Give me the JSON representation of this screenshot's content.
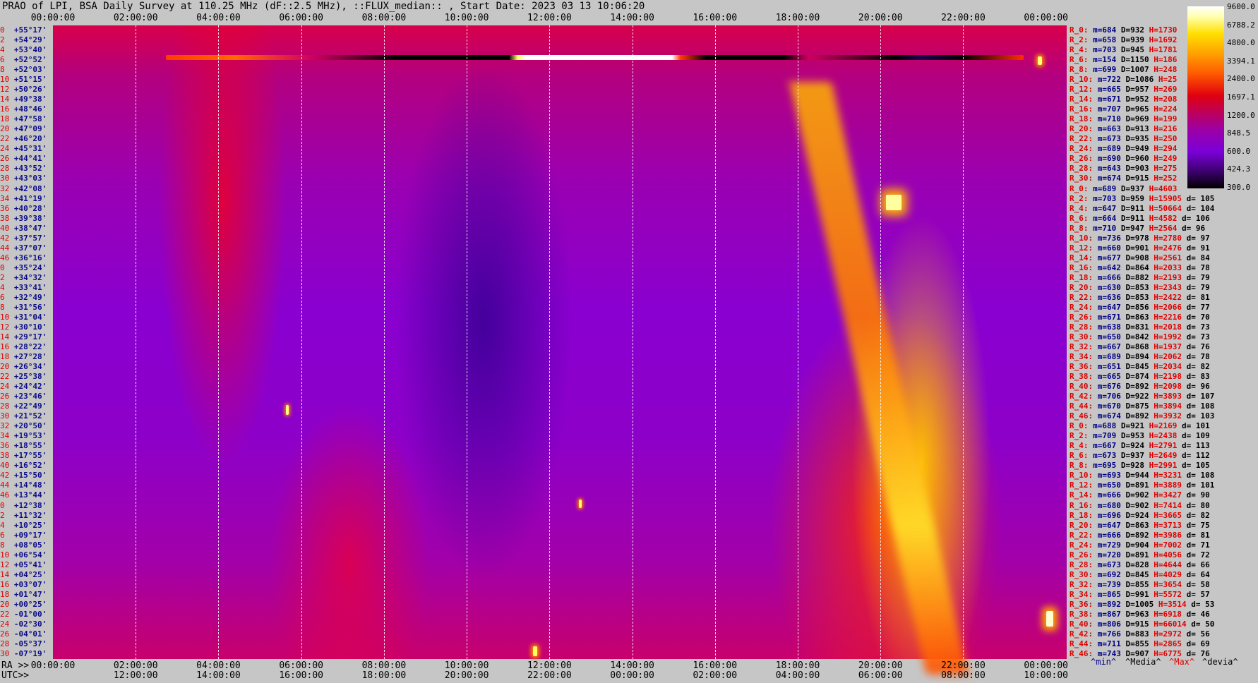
{
  "title": "PRAO of LPI, BSA Daily Survey at 110.25 MHz (dF::2.5 MHz), ::FLUX_median:: , Start Date: 2023 03 13 10:06:20",
  "top_axis": [
    "00:00:00",
    "02:00:00",
    "04:00:00",
    "06:00:00",
    "08:00:00",
    "10:00:00",
    "12:00:00",
    "14:00:00",
    "16:00:00",
    "18:00:00",
    "20:00:00",
    "22:00:00",
    "00:00:00"
  ],
  "bottom_axis": {
    "ra_prefix": "RA >>",
    "ra": [
      "00:00:00",
      "02:00:00",
      "04:00:00",
      "06:00:00",
      "08:00:00",
      "10:00:00",
      "12:00:00",
      "14:00:00",
      "16:00:00",
      "18:00:00",
      "20:00:00",
      "22:00:00",
      "00:00:00"
    ],
    "utc_prefix": "UTC>>",
    "utc": [
      "12:00:00",
      "14:00:00",
      "16:00:00",
      "18:00:00",
      "20:00:00",
      "22:00:00",
      "00:00:00",
      "02:00:00",
      "04:00:00",
      "06:00:00",
      "08:00:00",
      "10:00:00"
    ]
  },
  "declinations": [
    {
      "n": "0",
      "v": "+55°17'"
    },
    {
      "n": "2",
      "v": "+54°29'"
    },
    {
      "n": "4",
      "v": "+53°40'"
    },
    {
      "n": "6",
      "v": "+52°52'"
    },
    {
      "n": "8",
      "v": "+52°03'"
    },
    {
      "n": "10",
      "v": "+51°15'"
    },
    {
      "n": "12",
      "v": "+50°26'"
    },
    {
      "n": "14",
      "v": "+49°38'"
    },
    {
      "n": "16",
      "v": "+48°46'"
    },
    {
      "n": "18",
      "v": "+47°58'"
    },
    {
      "n": "20",
      "v": "+47°09'"
    },
    {
      "n": "22",
      "v": "+46°20'"
    },
    {
      "n": "24",
      "v": "+45°31'"
    },
    {
      "n": "26",
      "v": "+44°41'"
    },
    {
      "n": "28",
      "v": "+43°52'"
    },
    {
      "n": "30",
      "v": "+43°03'"
    },
    {
      "n": "32",
      "v": "+42°08'"
    },
    {
      "n": "34",
      "v": "+41°19'"
    },
    {
      "n": "36",
      "v": "+40°28'"
    },
    {
      "n": "38",
      "v": "+39°38'"
    },
    {
      "n": "40",
      "v": "+38°47'"
    },
    {
      "n": "42",
      "v": "+37°57'"
    },
    {
      "n": "44",
      "v": "+37°07'"
    },
    {
      "n": "46",
      "v": "+36°16'"
    },
    {
      "n": "0",
      "v": "+35°24'"
    },
    {
      "n": "2",
      "v": "+34°32'"
    },
    {
      "n": "4",
      "v": "+33°41'"
    },
    {
      "n": "6",
      "v": "+32°49'"
    },
    {
      "n": "8",
      "v": "+31°56'"
    },
    {
      "n": "10",
      "v": "+31°04'"
    },
    {
      "n": "12",
      "v": "+30°10'"
    },
    {
      "n": "14",
      "v": "+29°17'"
    },
    {
      "n": "16",
      "v": "+28°22'"
    },
    {
      "n": "18",
      "v": "+27°28'"
    },
    {
      "n": "20",
      "v": "+26°34'"
    },
    {
      "n": "22",
      "v": "+25°38'"
    },
    {
      "n": "24",
      "v": "+24°42'"
    },
    {
      "n": "26",
      "v": "+23°46'"
    },
    {
      "n": "28",
      "v": "+22°49'"
    },
    {
      "n": "30",
      "v": "+21°52'"
    },
    {
      "n": "32",
      "v": "+20°50'"
    },
    {
      "n": "34",
      "v": "+19°53'"
    },
    {
      "n": "36",
      "v": "+18°55'"
    },
    {
      "n": "38",
      "v": "+17°55'"
    },
    {
      "n": "40",
      "v": "+16°52'"
    },
    {
      "n": "42",
      "v": "+15°50'"
    },
    {
      "n": "44",
      "v": "+14°48'"
    },
    {
      "n": "46",
      "v": "+13°44'"
    },
    {
      "n": "0",
      "v": "+12°38'"
    },
    {
      "n": "2",
      "v": "+11°32'"
    },
    {
      "n": "4",
      "v": "+10°25'"
    },
    {
      "n": "6",
      "v": "+09°17'"
    },
    {
      "n": "8",
      "v": "+08°05'"
    },
    {
      "n": "10",
      "v": "+06°54'"
    },
    {
      "n": "12",
      "v": "+05°41'"
    },
    {
      "n": "14",
      "v": "+04°25'"
    },
    {
      "n": "16",
      "v": "+03°07'"
    },
    {
      "n": "18",
      "v": "+01°47'"
    },
    {
      "n": "20",
      "v": "+00°25'"
    },
    {
      "n": "22",
      "v": "-01°00'"
    },
    {
      "n": "24",
      "v": "-02°30'"
    },
    {
      "n": "26",
      "v": "-04°01'"
    },
    {
      "n": "28",
      "v": "-05°37'"
    },
    {
      "n": "30",
      "v": "-07°19'"
    }
  ],
  "stats": [
    {
      "r": "R_0:",
      "m": "m=684",
      "D": "D=932",
      "H": "H=1730",
      "d": ""
    },
    {
      "r": "R_2:",
      "m": "m=658",
      "D": "D=939",
      "H": "H=1692",
      "d": ""
    },
    {
      "r": "R_4:",
      "m": "m=703",
      "D": "D=945",
      "H": "H=1781",
      "d": ""
    },
    {
      "r": "R_6:",
      "m": "m=154",
      "D": "D=1150",
      "H": "H=186",
      "d": ""
    },
    {
      "r": "R_8:",
      "m": "m=699",
      "D": "D=1007",
      "H": "H=248",
      "d": ""
    },
    {
      "r": "R_10:",
      "m": "m=722",
      "D": "D=1086",
      "H": "H=25",
      "d": ""
    },
    {
      "r": "R_12:",
      "m": "m=665",
      "D": "D=957",
      "H": "H=269",
      "d": ""
    },
    {
      "r": "R_14:",
      "m": "m=671",
      "D": "D=952",
      "H": "H=208",
      "d": ""
    },
    {
      "r": "R_16:",
      "m": "m=707",
      "D": "D=965",
      "H": "H=224",
      "d": ""
    },
    {
      "r": "R_18:",
      "m": "m=710",
      "D": "D=969",
      "H": "H=199",
      "d": ""
    },
    {
      "r": "R_20:",
      "m": "m=663",
      "D": "D=913",
      "H": "H=216",
      "d": ""
    },
    {
      "r": "R_22:",
      "m": "m=673",
      "D": "D=935",
      "H": "H=250",
      "d": ""
    },
    {
      "r": "R_24:",
      "m": "m=689",
      "D": "D=949",
      "H": "H=294",
      "d": ""
    },
    {
      "r": "R_26:",
      "m": "m=690",
      "D": "D=960",
      "H": "H=249",
      "d": ""
    },
    {
      "r": "R_28:",
      "m": "m=643",
      "D": "D=903",
      "H": "H=275",
      "d": ""
    },
    {
      "r": "R_30:",
      "m": "m=674",
      "D": "D=915",
      "H": "H=252",
      "d": ""
    },
    {
      "r": "R_0:",
      "m": "m=689",
      "D": "D=937",
      "H": "H=4603",
      "d": ""
    },
    {
      "r": "R_2:",
      "m": "m=703",
      "D": "D=959",
      "H": "H=15905",
      "d": "d= 105"
    },
    {
      "r": "R_4:",
      "m": "m=647",
      "D": "D=911",
      "H": "H=50664",
      "d": "d= 104"
    },
    {
      "r": "R_6:",
      "m": "m=664",
      "D": "D=911",
      "H": "H=4582",
      "d": "d= 106"
    },
    {
      "r": "R_8:",
      "m": "m=710",
      "D": "D=947",
      "H": "H=2564",
      "d": "d= 96"
    },
    {
      "r": "R_10:",
      "m": "m=736",
      "D": "D=978",
      "H": "H=2780",
      "d": "d= 97"
    },
    {
      "r": "R_12:",
      "m": "m=660",
      "D": "D=901",
      "H": "H=2476",
      "d": "d= 91"
    },
    {
      "r": "R_14:",
      "m": "m=677",
      "D": "D=908",
      "H": "H=2561",
      "d": "d= 84"
    },
    {
      "r": "R_16:",
      "m": "m=642",
      "D": "D=864",
      "H": "H=2033",
      "d": "d= 78"
    },
    {
      "r": "R_18:",
      "m": "m=666",
      "D": "D=882",
      "H": "H=2193",
      "d": "d= 79"
    },
    {
      "r": "R_20:",
      "m": "m=630",
      "D": "D=853",
      "H": "H=2343",
      "d": "d= 79"
    },
    {
      "r": "R_22:",
      "m": "m=636",
      "D": "D=853",
      "H": "H=2422",
      "d": "d= 81"
    },
    {
      "r": "R_24:",
      "m": "m=647",
      "D": "D=856",
      "H": "H=2066",
      "d": "d= 77"
    },
    {
      "r": "R_26:",
      "m": "m=671",
      "D": "D=863",
      "H": "H=2216",
      "d": "d= 70"
    },
    {
      "r": "R_28:",
      "m": "m=638",
      "D": "D=831",
      "H": "H=2018",
      "d": "d= 73"
    },
    {
      "r": "R_30:",
      "m": "m=650",
      "D": "D=842",
      "H": "H=1992",
      "d": "d= 73"
    },
    {
      "r": "R_32:",
      "m": "m=667",
      "D": "D=868",
      "H": "H=1937",
      "d": "d= 76"
    },
    {
      "r": "R_34:",
      "m": "m=689",
      "D": "D=894",
      "H": "H=2062",
      "d": "d= 78"
    },
    {
      "r": "R_36:",
      "m": "m=651",
      "D": "D=845",
      "H": "H=2034",
      "d": "d= 82"
    },
    {
      "r": "R_38:",
      "m": "m=665",
      "D": "D=874",
      "H": "H=2198",
      "d": "d= 83"
    },
    {
      "r": "R_40:",
      "m": "m=676",
      "D": "D=892",
      "H": "H=2098",
      "d": "d= 96"
    },
    {
      "r": "R_42:",
      "m": "m=706",
      "D": "D=922",
      "H": "H=3893",
      "d": "d= 107"
    },
    {
      "r": "R_44:",
      "m": "m=670",
      "D": "D=875",
      "H": "H=3894",
      "d": "d= 108"
    },
    {
      "r": "R_46:",
      "m": "m=674",
      "D": "D=892",
      "H": "H=3932",
      "d": "d= 103"
    },
    {
      "r": "R_0:",
      "m": "m=688",
      "D": "D=921",
      "H": "H=2169",
      "d": "d= 101"
    },
    {
      "r": "R_2:",
      "m": "m=709",
      "D": "D=953",
      "H": "H=2438",
      "d": "d= 109"
    },
    {
      "r": "R_4:",
      "m": "m=667",
      "D": "D=924",
      "H": "H=2791",
      "d": "d= 113"
    },
    {
      "r": "R_6:",
      "m": "m=673",
      "D": "D=937",
      "H": "H=2649",
      "d": "d= 112"
    },
    {
      "r": "R_8:",
      "m": "m=695",
      "D": "D=928",
      "H": "H=2991",
      "d": "d= 105"
    },
    {
      "r": "R_10:",
      "m": "m=693",
      "D": "D=944",
      "H": "H=3231",
      "d": "d= 108"
    },
    {
      "r": "R_12:",
      "m": "m=650",
      "D": "D=891",
      "H": "H=3889",
      "d": "d= 101"
    },
    {
      "r": "R_14:",
      "m": "m=666",
      "D": "D=902",
      "H": "H=3427",
      "d": "d= 90"
    },
    {
      "r": "R_16:",
      "m": "m=680",
      "D": "D=902",
      "H": "H=7414",
      "d": "d= 80"
    },
    {
      "r": "R_18:",
      "m": "m=696",
      "D": "D=924",
      "H": "H=3665",
      "d": "d= 82"
    },
    {
      "r": "R_20:",
      "m": "m=647",
      "D": "D=863",
      "H": "H=3713",
      "d": "d= 75"
    },
    {
      "r": "R_22:",
      "m": "m=666",
      "D": "D=892",
      "H": "H=3986",
      "d": "d= 81"
    },
    {
      "r": "R_24:",
      "m": "m=729",
      "D": "D=904",
      "H": "H=7002",
      "d": "d= 71"
    },
    {
      "r": "R_26:",
      "m": "m=720",
      "D": "D=891",
      "H": "H=4056",
      "d": "d= 72"
    },
    {
      "r": "R_28:",
      "m": "m=673",
      "D": "D=828",
      "H": "H=4644",
      "d": "d= 66"
    },
    {
      "r": "R_30:",
      "m": "m=692",
      "D": "D=845",
      "H": "H=4029",
      "d": "d= 64"
    },
    {
      "r": "R_32:",
      "m": "m=739",
      "D": "D=855",
      "H": "H=3654",
      "d": "d= 58"
    },
    {
      "r": "R_34:",
      "m": "m=865",
      "D": "D=991",
      "H": "H=5572",
      "d": "d= 57"
    },
    {
      "r": "R_36:",
      "m": "m=892",
      "D": "D=1005",
      "H": "H=3514",
      "d": "d= 53"
    },
    {
      "r": "R_38:",
      "m": "m=867",
      "D": "D=963",
      "H": "H=6918",
      "d": "d= 46"
    },
    {
      "r": "R_40:",
      "m": "m=806",
      "D": "D=915",
      "H": "H=66014",
      "d": "d= 50"
    },
    {
      "r": "R_42:",
      "m": "m=766",
      "D": "D=883",
      "H": "H=2972",
      "d": "d= 56"
    },
    {
      "r": "R_44:",
      "m": "m=711",
      "D": "D=855",
      "H": "H=2865",
      "d": "d= 69"
    },
    {
      "r": "R_46:",
      "m": "m=743",
      "D": "D=907",
      "H": "H=6775",
      "d": "d= 76"
    }
  ],
  "colorbar": [
    "9600.0",
    "6788.2",
    "4800.0",
    "3394.1",
    "2400.0",
    "1697.1",
    "1200.0",
    "848.5",
    "600.0",
    "424.3",
    "300.0"
  ],
  "legend": {
    "min": "^min^",
    "median": "^Media^",
    "max": "^Max^",
    "devia": "^devia^"
  },
  "colors": {
    "row_index": "#dd0000",
    "declination": "#0a0a8a",
    "min": "#000084",
    "max": "#e00000",
    "background": "#c6c6c6"
  }
}
